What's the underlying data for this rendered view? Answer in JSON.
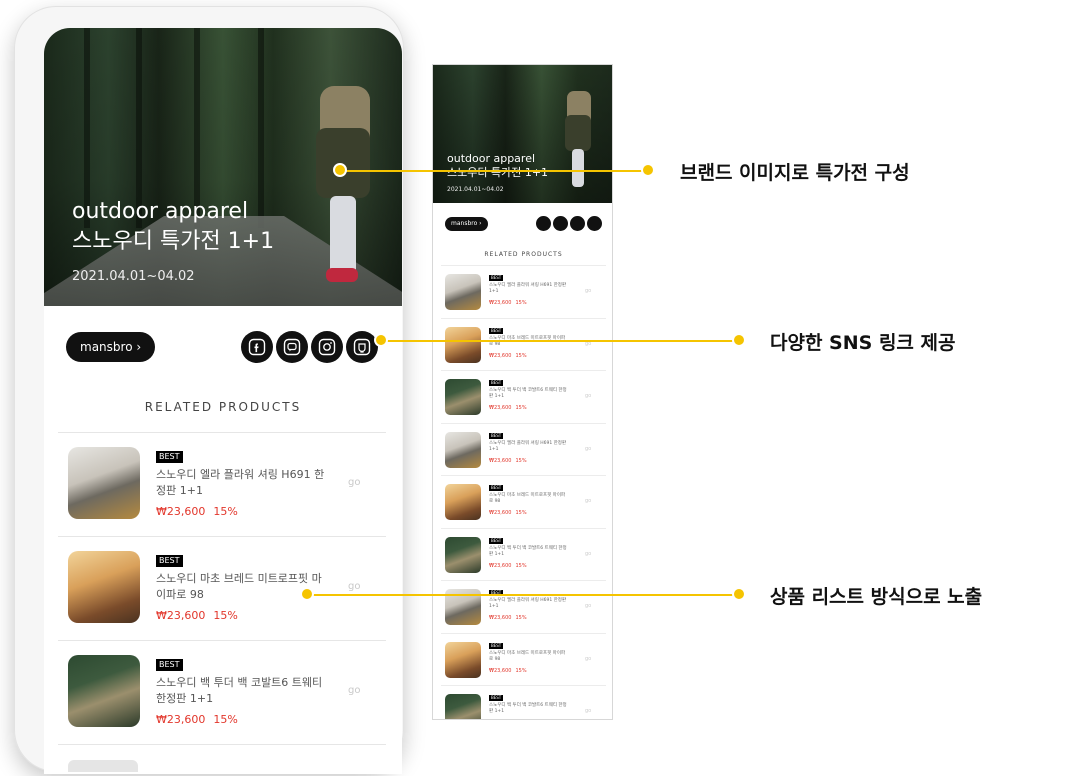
{
  "hero": {
    "title_line1": "outdoor apparel",
    "title_line2": "스노우디 특가전 1+1",
    "date": "2021.04.01~04.02"
  },
  "brand": {
    "label": "mansbro ›"
  },
  "sns": [
    {
      "icon": "facebook-icon"
    },
    {
      "icon": "chat-icon"
    },
    {
      "icon": "instagram-icon"
    },
    {
      "icon": "shop-icon"
    }
  ],
  "related": {
    "title": "RELATED PRODUCTS"
  },
  "products": [
    {
      "badge": "BEST",
      "name": "스노우디 엘라 플라워 셔링 H691 한정판 1+1",
      "price": "₩23,600",
      "discount": "15%",
      "go": "go"
    },
    {
      "badge": "BEST",
      "name": "스노우디 마초 브레드 미트로프핏 마이파로 98",
      "price": "₩23,600",
      "discount": "15%",
      "go": "go"
    },
    {
      "badge": "BEST",
      "name": "스노우디 백 투더 백 코발트6 트웨티 한정판 1+1",
      "price": "₩23,600",
      "discount": "15%",
      "go": "go"
    }
  ],
  "preview_products": [
    {
      "badge": "BEST",
      "name": "스노우디 엘라 플라워 셔링 H691 한정판 1+1",
      "price": "₩23,600",
      "discount": "15%",
      "go": "go"
    },
    {
      "badge": "BEST",
      "name": "스노우디 마초 브레드 미트로프핏 마이파로 98",
      "price": "₩23,600",
      "discount": "15%",
      "go": "go"
    },
    {
      "badge": "BEST",
      "name": "스노우디 백 투더 백 코발트6 트웨티 한정판 1+1",
      "price": "₩23,600",
      "discount": "15%",
      "go": "go"
    },
    {
      "badge": "BEST",
      "name": "스노우디 엘라 플라워 셔링 H691 한정판 1+1",
      "price": "₩23,600",
      "discount": "15%",
      "go": "go"
    },
    {
      "badge": "BEST",
      "name": "스노우디 마초 브레드 미트로프핏 마이파로 98",
      "price": "₩23,600",
      "discount": "15%",
      "go": "go"
    },
    {
      "badge": "BEST",
      "name": "스노우디 백 투더 백 코발트6 트웨티 한정판 1+1",
      "price": "₩23,600",
      "discount": "15%",
      "go": "go"
    },
    {
      "badge": "BEST",
      "name": "스노우디 엘라 플라워 셔링 H691 한정판 1+1",
      "price": "₩23,600",
      "discount": "15%",
      "go": "go"
    },
    {
      "badge": "BEST",
      "name": "스노우디 마초 브레드 미트로프핏 마이파로 98",
      "price": "₩23,600",
      "discount": "15%",
      "go": "go"
    },
    {
      "badge": "BEST",
      "name": "스노우디 백 투더 백 코발트6 트웨티 한정판 1+1",
      "price": "₩23,600",
      "discount": "15%",
      "go": "go"
    }
  ],
  "callouts": [
    "브랜드 이미지로 특가전 구성",
    "다양한 SNS 링크 제공",
    "상품 리스트 방식으로 노출"
  ],
  "colors": {
    "accent": "#f5c400",
    "price": "#e2362b",
    "dark": "#111111"
  }
}
